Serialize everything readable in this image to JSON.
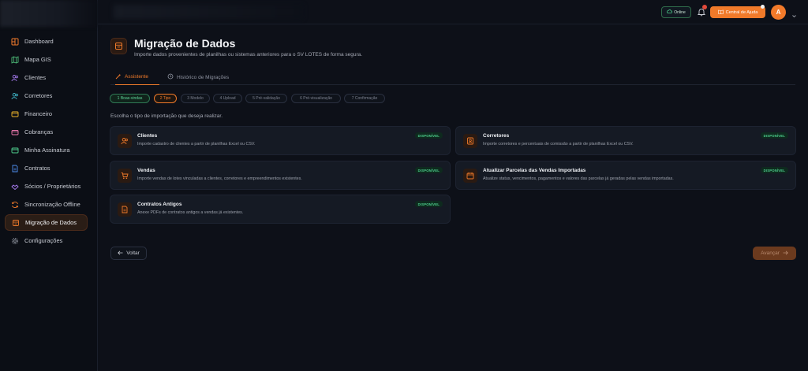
{
  "sidebar": {
    "items": [
      {
        "label": "Dashboard",
        "icon": "dashboard-icon",
        "color": "#f07a2a"
      },
      {
        "label": "Mapa GIS",
        "icon": "map-icon",
        "color": "#4fbf7a"
      },
      {
        "label": "Clientes",
        "icon": "users-icon",
        "color": "#a77bf0"
      },
      {
        "label": "Corretores",
        "icon": "user-tie-icon",
        "color": "#3fb6c8"
      },
      {
        "label": "Financeiro",
        "icon": "wallet-icon",
        "color": "#f0b52a"
      },
      {
        "label": "Cobranças",
        "icon": "bill-icon",
        "color": "#f07ab0"
      },
      {
        "label": "Minha Assinatura",
        "icon": "card-icon",
        "color": "#4fd08f"
      },
      {
        "label": "Contratos",
        "icon": "document-icon",
        "color": "#4f8ff0"
      },
      {
        "label": "Sócios / Proprietários",
        "icon": "partners-icon",
        "color": "#a77bf0"
      },
      {
        "label": "Sincronização Offline",
        "icon": "sync-icon",
        "color": "#f07a2a"
      },
      {
        "label": "Migração de Dados",
        "icon": "migration-icon",
        "color": "#f07a2a",
        "active": true
      },
      {
        "label": "Configurações",
        "icon": "gear-icon",
        "color": "#9ba0ab"
      }
    ]
  },
  "topbar": {
    "online_label": "Online",
    "help_label": "Central de Ajuda",
    "avatar_initial": "A",
    "notification_count": "26"
  },
  "page": {
    "title": "Migração de Dados",
    "subtitle": "Importe dados provenientes de planilhas ou sistemas anteriores para o SV LOTES de forma segura."
  },
  "tabs": [
    {
      "label": "Assistente",
      "active": true
    },
    {
      "label": "Histórico de Migrações",
      "active": false
    }
  ],
  "steps": [
    {
      "label": "1 Boas-vindas",
      "state": "done"
    },
    {
      "label": "2 Tipo",
      "state": "current"
    },
    {
      "label": "3 Modelo",
      "state": "todo"
    },
    {
      "label": "4 Upload",
      "state": "todo"
    },
    {
      "label": "5 Pré-validação",
      "state": "todo"
    },
    {
      "label": "6 Pré-visualização",
      "state": "todo"
    },
    {
      "label": "7 Confirmação",
      "state": "todo"
    }
  ],
  "instruction": "Escolha o tipo de importação que deseja realizar.",
  "cards": [
    {
      "title": "Clientes",
      "desc": "Importe cadastro de clientes a partir de planilhas Excel ou CSV.",
      "badge": "DISPONÍVEL"
    },
    {
      "title": "Corretores",
      "desc": "Importe corretores e percentuais de comissão a partir de planilhas Excel ou CSV.",
      "badge": "DISPONÍVEL"
    },
    {
      "title": "Vendas",
      "desc": "Importe vendas de lotes vinculadas a clientes, corretores e empreendimentos existentes.",
      "badge": "DISPONÍVEL"
    },
    {
      "title": "Atualizar Parcelas das Vendas Importadas",
      "desc": "Atualize status, vencimentos, pagamentos e valores das parcelas já geradas pelas vendas importadas.",
      "badge": "DISPONÍVEL"
    },
    {
      "title": "Contratos Antigos",
      "desc": "Anexe PDFs de contratos antigos a vendas já existentes.",
      "badge": "DISPONÍVEL"
    }
  ],
  "actions": {
    "back_label": "Voltar",
    "next_label": "Avançar"
  },
  "colors": {
    "accent": "#f07a2a",
    "success": "#4fd08f",
    "background": "#0d1018",
    "card": "#151a24"
  }
}
